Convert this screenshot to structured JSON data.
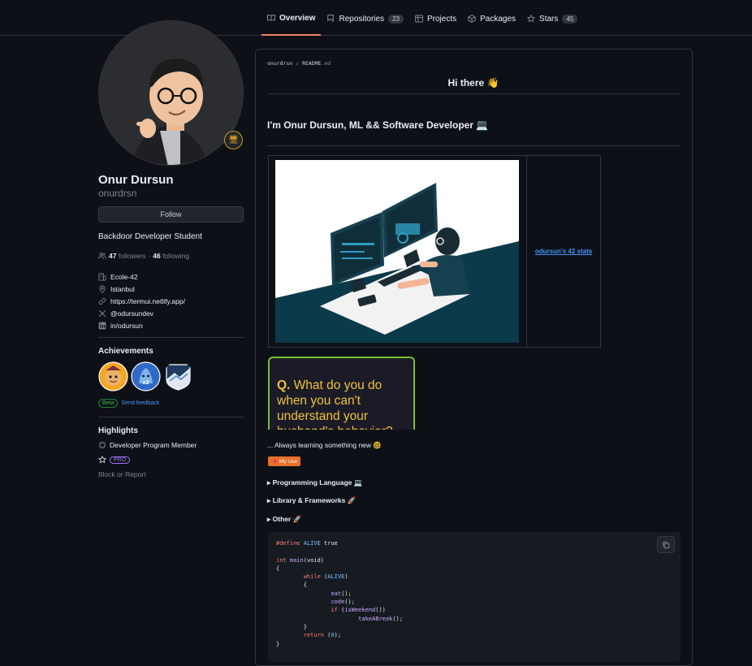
{
  "tabs": [
    {
      "label": "Overview",
      "icon": "book-icon"
    },
    {
      "label": "Repositories",
      "count": "23",
      "icon": "repo-icon"
    },
    {
      "label": "Projects",
      "icon": "table-icon"
    },
    {
      "label": "Packages",
      "icon": "package-icon"
    },
    {
      "label": "Stars",
      "count": "45",
      "icon": "star-icon"
    }
  ],
  "profile": {
    "name": "Onur Dursun",
    "login": "onurdrsn",
    "follow_label": "Follow",
    "bio": "Backdoor Developer Student",
    "followers_count": "47",
    "followers_label": "followers",
    "following_count": "46",
    "following_label": "following",
    "separator": "·",
    "details": [
      {
        "icon": "organization-icon",
        "text": "Ecole-42"
      },
      {
        "icon": "location-icon",
        "text": "Istanbul"
      },
      {
        "icon": "link-icon",
        "text": "https://termui.netlify.app/"
      },
      {
        "icon": "x-icon",
        "text": "@odursundev"
      },
      {
        "icon": "linkedin-icon",
        "text": "in/odursun"
      }
    ]
  },
  "achievements": {
    "title": "Achievements",
    "beta_label": "Beta",
    "feedback_label": "Send feedback"
  },
  "highlights": {
    "title": "Highlights",
    "program": "Developer Program Member",
    "pro_label": "PRO"
  },
  "block_label": "Block or Report",
  "readme": {
    "path_user": "onurdrsn",
    "path_sep": " / ",
    "path_file": "README",
    "path_ext": ".md",
    "heading": "Hi there 👋",
    "intro": "I'm Onur Dursun, ML && Software Developer 💻",
    "stats_link": "odursun's 42 stats",
    "quote_q": "Q.",
    "quote_text": " What do you do when you can't understand your husband's behavior?",
    "learning": "... Always learning something new 🤓",
    "myuse_label": "📌 My Use",
    "sections": [
      "▸ Programming Language 💻",
      "▸ Library & Frameworks 🚀",
      "▸ Other 🚀"
    ]
  },
  "code": {
    "line1_pp": "#define",
    "line1_name": "ALIVE",
    "line1_val": "true",
    "line3_type": "int",
    "line3_fn": "main",
    "line3_rest": "(void)",
    "while_kw": "while",
    "while_arg": "ALIVE",
    "eat": "eat",
    "code_fn": "code",
    "if_kw": "if",
    "weekend": "isWeekend",
    "break_fn": "takeABreak",
    "return_kw": "return",
    "return_val": "0"
  }
}
